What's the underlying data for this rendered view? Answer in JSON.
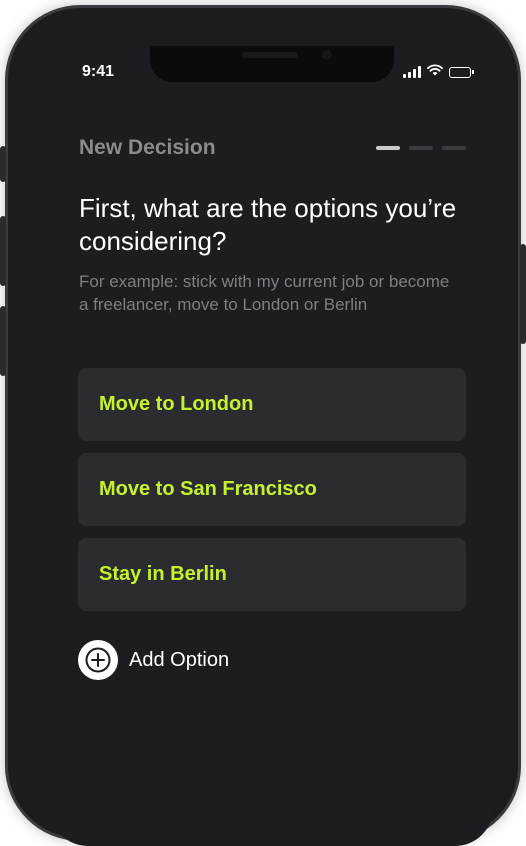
{
  "status_bar": {
    "time": "9:41",
    "signal_icon": "cellular-signal-icon",
    "wifi_icon": "wifi-icon",
    "battery_icon": "battery-icon"
  },
  "header": {
    "title": "New Decision",
    "progress_steps": 3,
    "progress_current_step": 1
  },
  "question": {
    "title": "First, what are the options you’re considering?",
    "hint": "For example: stick with my current job or become a freelancer, move to London or Berlin"
  },
  "options": [
    {
      "label": "Move to London"
    },
    {
      "label": "Move to San Francisco"
    },
    {
      "label": "Stay in Berlin"
    }
  ],
  "add_option": {
    "label": "Add Option",
    "icon": "plus-circle-icon"
  },
  "colors": {
    "background": "#1c1d21",
    "card": "#2b2c30",
    "accent": "#c5f22d",
    "muted_text": "#7e7f83"
  }
}
